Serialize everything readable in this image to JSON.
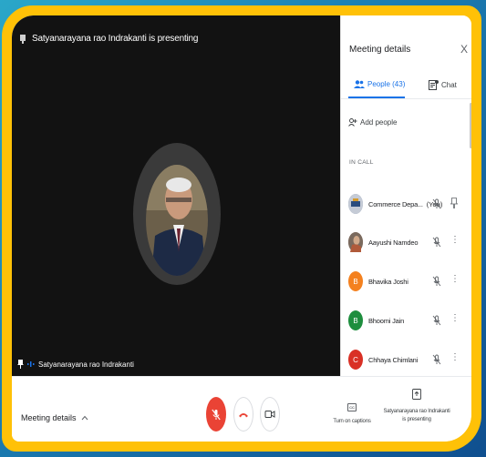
{
  "stage": {
    "presenting_banner": "Satyanarayana rao Indrakanti is presenting",
    "tile_name": "Satyanarayana rao Indrakanti"
  },
  "panel": {
    "title": "Meeting details",
    "close": "X",
    "tabs": [
      {
        "label": "People (43)",
        "active": true
      },
      {
        "label": "Chat",
        "active": false
      }
    ],
    "add_people": "Add people",
    "section_label": "IN CALL",
    "people": [
      {
        "name": "Commerce Depa...",
        "you": "(You)",
        "avatar_color": "#8a9bb0",
        "initial": "",
        "trailing": "pin-icon"
      },
      {
        "name": "Aayushi Namdeo",
        "you": "",
        "avatar_color": "#9c7b6a",
        "initial": "",
        "trailing": "more-icon"
      },
      {
        "name": "Bhavika Joshi",
        "you": "",
        "avatar_color": "#f4811f",
        "initial": "B",
        "trailing": "more-icon"
      },
      {
        "name": "Bhoomi Jain",
        "you": "",
        "avatar_color": "#1e8e3e",
        "initial": "B",
        "trailing": "more-icon"
      },
      {
        "name": "Chhaya Chimlani",
        "you": "",
        "avatar_color": "#d93025",
        "initial": "C",
        "trailing": "more-icon"
      }
    ]
  },
  "bottom": {
    "meeting_details": "Meeting details",
    "captions_icon_text": "CC",
    "captions_label": "Turn on captions",
    "presenting_label_1": "Satyanarayana rao Indrakanti",
    "presenting_label_2": "is presenting"
  },
  "colors": {
    "accent": "#1a73e8",
    "frame": "#ffc107",
    "mic_off": "#ea4335"
  }
}
